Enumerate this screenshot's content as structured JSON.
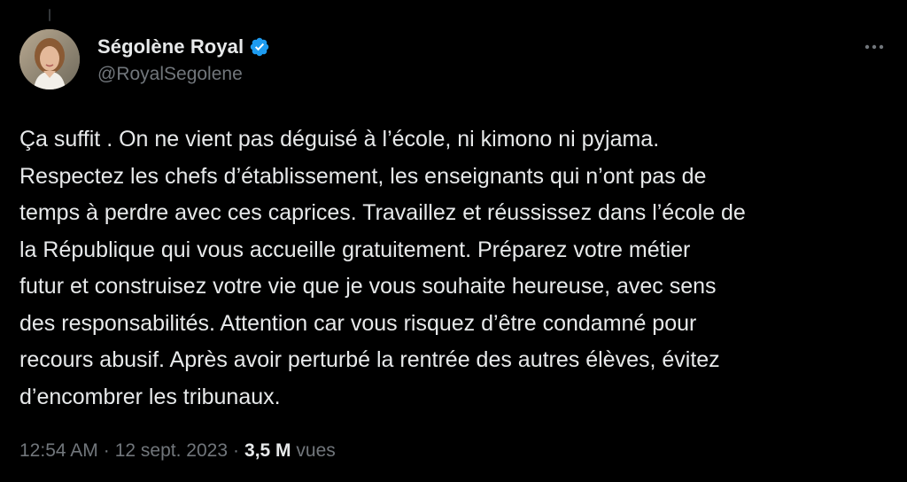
{
  "author": {
    "display_name": "Ségolène Royal",
    "handle": "@RoyalSegolene",
    "verified": true,
    "verified_color": "#1d9bf0"
  },
  "tweet": {
    "text": "Ça suffit . On ne vient pas déguisé à l’école, ni kimono ni pyjama.\nRespectez les chefs d’établissement, les enseignants qui n’ont pas de\ntemps à perdre avec ces caprices. Travaillez et réussissez dans l’école de\nla République qui vous accueille gratuitement. Préparez votre métier\nfutur et construisez votre vie que je vous souhaite heureuse, avec sens\ndes responsabilités. Attention car vous risquez d’être  condamné pour\nrecours abusif. Après avoir perturbé la rentrée des autres élèves, évitez\nd’encombrer les tribunaux."
  },
  "meta": {
    "time": "12:54 AM",
    "separator": "·",
    "date": "12 sept. 2023",
    "views_count": "3,5 M",
    "views_label": "vues"
  },
  "icons": {
    "more": "more-horizontal-icon",
    "verified": "verified-badge-icon"
  },
  "colors": {
    "background": "#000000",
    "text_primary": "#e7e9ea",
    "text_secondary": "#71767b"
  }
}
